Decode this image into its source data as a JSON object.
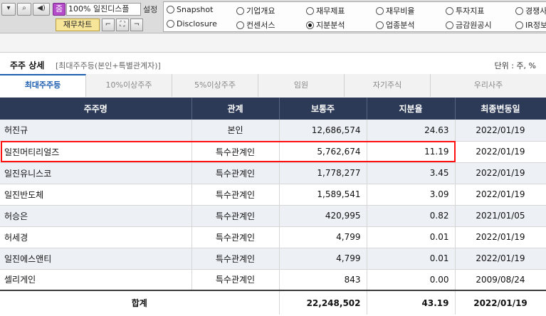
{
  "toolbar": {
    "zoom_icon": "줌",
    "zoom_value": "100% 일진디스플",
    "settings_label": "설정",
    "fin_chart_label": "재무차트"
  },
  "radio_options": [
    {
      "label": "Snapshot",
      "selected": false
    },
    {
      "label": "기업개요",
      "selected": false
    },
    {
      "label": "재무제표",
      "selected": false
    },
    {
      "label": "재무비율",
      "selected": false
    },
    {
      "label": "투자지표",
      "selected": false
    },
    {
      "label": "경쟁사",
      "selected": false
    },
    {
      "label": "Disclosure",
      "selected": false
    },
    {
      "label": "컨센서스",
      "selected": false
    },
    {
      "label": "지분분석",
      "selected": true
    },
    {
      "label": "업종분석",
      "selected": false
    },
    {
      "label": "금감원공시",
      "selected": false
    },
    {
      "label": "IR정보",
      "selected": false
    }
  ],
  "section": {
    "title": "주주 상세",
    "subtitle": "[최대주주등(본인+특별관계자)]",
    "unit": "단위 : 주, %"
  },
  "tabs": [
    {
      "label": "최대주주등",
      "active": true
    },
    {
      "label": "10%이상주주",
      "active": false
    },
    {
      "label": "5%이상주주",
      "active": false
    },
    {
      "label": "임원",
      "active": false
    },
    {
      "label": "자기주식",
      "active": false
    },
    {
      "label": "우리사주",
      "active": false
    }
  ],
  "table": {
    "headers": [
      "주주명",
      "관계",
      "보통주",
      "지분율",
      "최종변동일"
    ],
    "rows": [
      {
        "name": "허진규",
        "relation": "본인",
        "shares": "12,686,574",
        "ratio": "24.63",
        "date": "2022/01/19"
      },
      {
        "name": "일진머티리얼즈",
        "relation": "특수관계인",
        "shares": "5,762,674",
        "ratio": "11.19",
        "date": "2022/01/19"
      },
      {
        "name": "일진유니스코",
        "relation": "특수관계인",
        "shares": "1,778,277",
        "ratio": "3.45",
        "date": "2022/01/19"
      },
      {
        "name": "일진반도체",
        "relation": "특수관계인",
        "shares": "1,589,541",
        "ratio": "3.09",
        "date": "2022/01/19"
      },
      {
        "name": "허승은",
        "relation": "특수관계인",
        "shares": "420,995",
        "ratio": "0.82",
        "date": "2021/01/05"
      },
      {
        "name": "허세경",
        "relation": "특수관계인",
        "shares": "4,799",
        "ratio": "0.01",
        "date": "2022/01/19"
      },
      {
        "name": "일진에스앤티",
        "relation": "특수관계인",
        "shares": "4,799",
        "ratio": "0.01",
        "date": "2022/01/19"
      },
      {
        "name": "셀리게인",
        "relation": "특수관계인",
        "shares": "843",
        "ratio": "0.00",
        "date": "2009/08/24"
      }
    ],
    "total": {
      "label": "합계",
      "shares": "22,248,502",
      "ratio": "43.19",
      "date": "2022/01/19"
    }
  },
  "colors": {
    "header_bg": "#2c3a57",
    "active_tab": "#1f5fb0",
    "highlight_box": "#ff1010",
    "odd_row": "#edf0f5"
  }
}
